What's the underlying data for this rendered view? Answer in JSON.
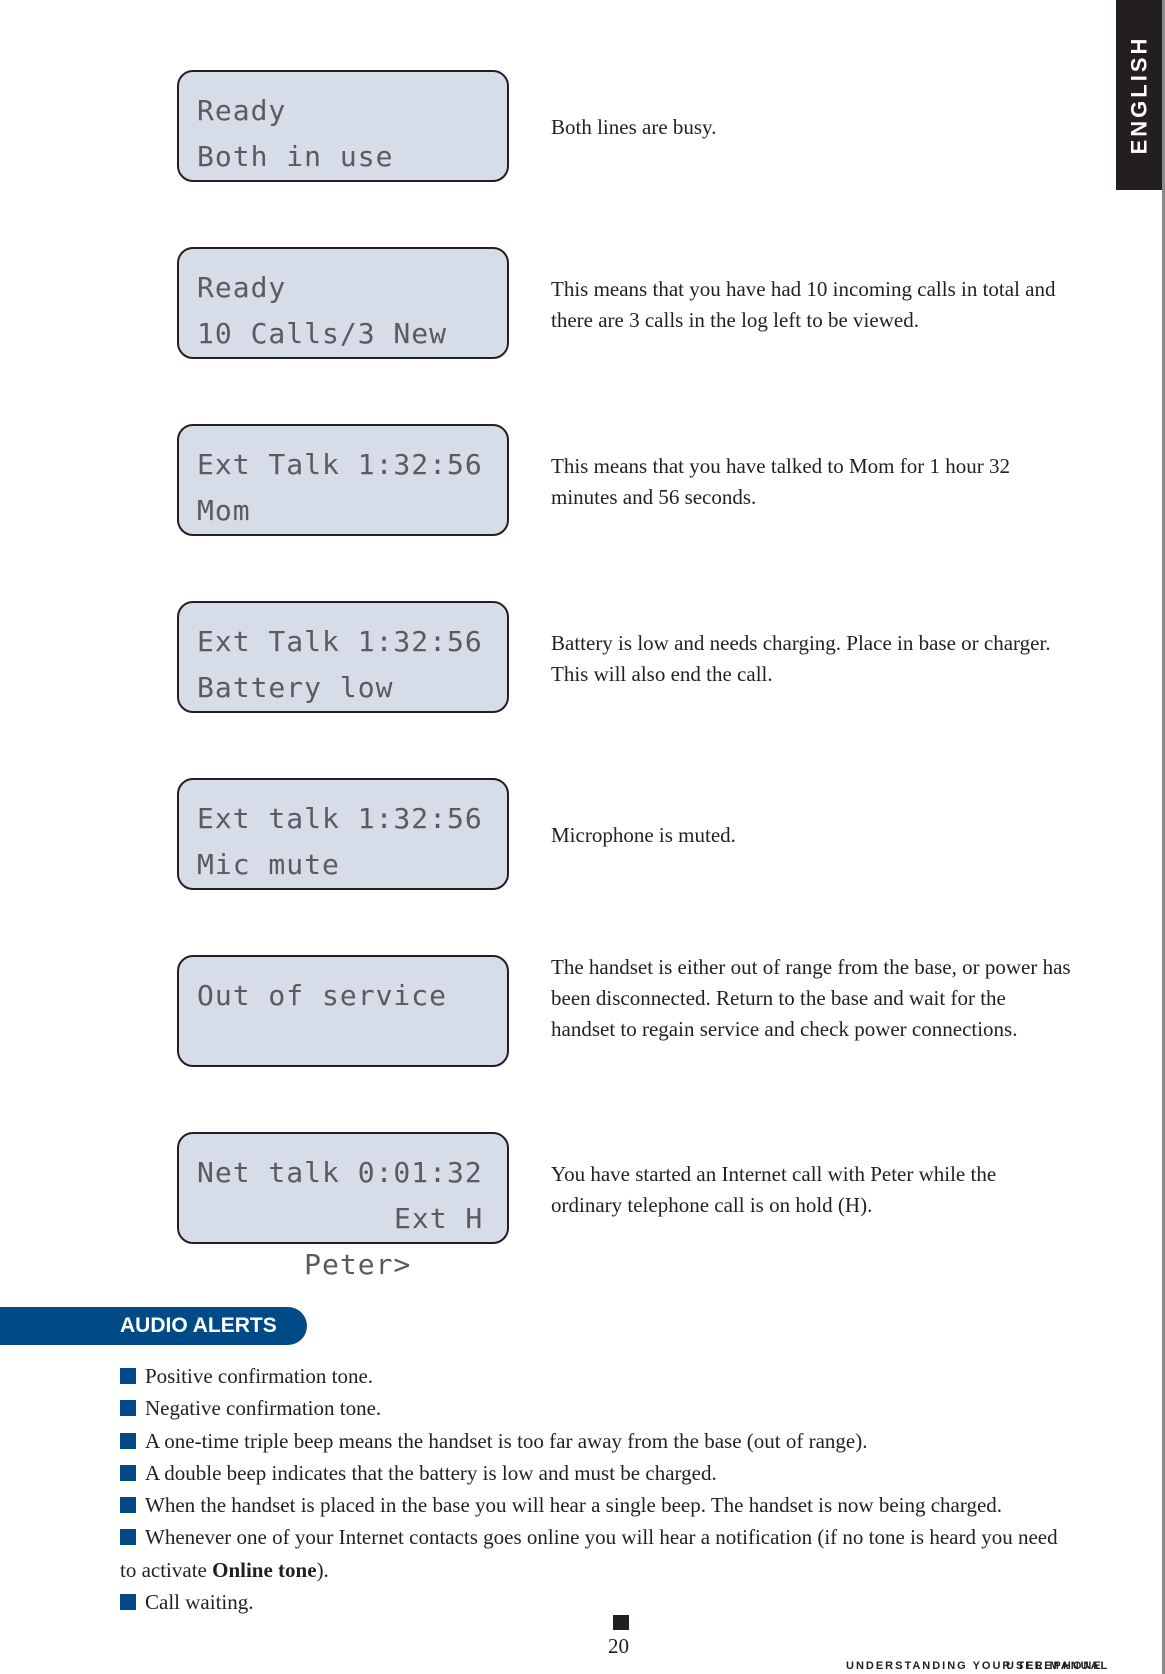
{
  "side_tab": {
    "label": "ENGLISH"
  },
  "displays": [
    {
      "line1": "Ready",
      "line2": "Both in use",
      "line2_right": "",
      "description": "Both lines are busy."
    },
    {
      "line1": "Ready",
      "line2": "10 Calls/3 New",
      "line2_right": "",
      "description": "This means that you have had 10 incoming calls in total and there are 3 calls in the log left to be viewed."
    },
    {
      "line1": "Ext Talk 1:32:56",
      "line2": "Mom",
      "line2_right": "",
      "description": "This means that you have talked to Mom for 1 hour 32 minutes and 56 seconds."
    },
    {
      "line1": "Ext Talk 1:32:56",
      "line2": "Battery low",
      "line2_right": "",
      "description": "Battery is low and needs charging. Place in base or charger. This will also end the call."
    },
    {
      "line1": "Ext talk 1:32:56",
      "line2": "Mic mute",
      "line2_right": "",
      "description": "Microphone is muted."
    },
    {
      "line1": "Out of service",
      "line2": "",
      "line2_right": "",
      "description": "The handset is either out of range from the base, or power has been disconnected. Return to the base and wait for the handset to regain service and check power connections."
    },
    {
      "line1": "Net talk 0:01:32",
      "line2": "Peter>",
      "line2_right": "Ext H",
      "description": "You have started an Internet call with Peter while the ordinary telephone call is on hold (H)."
    }
  ],
  "audio_alerts": {
    "heading": "AUDIO ALERTS",
    "items": [
      {
        "text": "Positive confirmation tone.",
        "bold": "",
        "after": ""
      },
      {
        "text": "Negative confirmation tone.",
        "bold": "",
        "after": ""
      },
      {
        "text": "A one-time triple beep means the handset is too far away from the base (out of range).",
        "bold": "",
        "after": ""
      },
      {
        "text": "A double beep indicates that the battery is low and must be charged.",
        "bold": "",
        "after": ""
      },
      {
        "text": "When the handset is placed in the base you will hear a single beep. The handset is now being charged.",
        "bold": "",
        "after": ""
      },
      {
        "text": "Whenever one of your Internet contacts goes online you will hear a notification (if no tone is heard you need to activate ",
        "bold": "Online tone",
        "after": ")."
      },
      {
        "text": "Call waiting.",
        "bold": "",
        "after": ""
      }
    ]
  },
  "page": {
    "number": "20"
  },
  "footer": {
    "text_a": "UNDERSTANDING YOUR TELEPHONE",
    "text_b": "USER MANUAL"
  },
  "colors": {
    "accent_blue": "#004b87",
    "lcd_bg": "#d7dce9",
    "tab_dark": "#231f20"
  }
}
